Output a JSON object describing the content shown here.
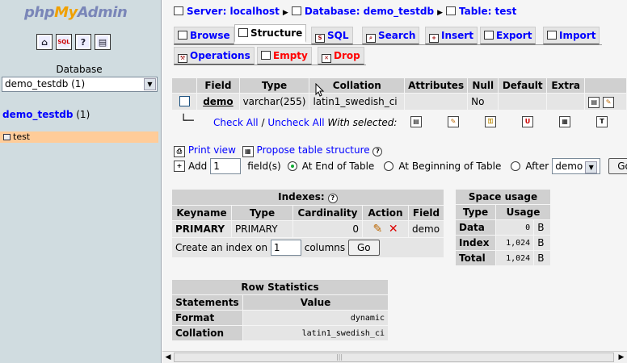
{
  "left": {
    "logo": {
      "php": "php",
      "my": "My",
      "admin": "Admin"
    },
    "icons": [
      "home-icon",
      "sql-query-icon",
      "help-icon",
      "docs-icon"
    ],
    "db_label": "Database",
    "db_selected": "demo_testdb (1)",
    "db_link_name": "demo_testdb",
    "db_link_count": "(1)",
    "table_item": "test",
    "bg_color": "#d0dce0",
    "highlight_color": "#ffcc99"
  },
  "breadcrumb": {
    "server": "Server: localhost",
    "database": "Database: demo_testdb",
    "table": "Table: test"
  },
  "tabs": {
    "browse": "Browse",
    "structure": "Structure",
    "sql": "SQL",
    "search": "Search",
    "insert": "Insert",
    "export": "Export",
    "import": "Import",
    "operations": "Operations",
    "empty": "Empty",
    "drop": "Drop"
  },
  "structure": {
    "headers": [
      "Field",
      "Type",
      "Collation",
      "Attributes",
      "Null",
      "Default",
      "Extra"
    ],
    "row": {
      "field": "demo",
      "type": "varchar(255)",
      "collation": "latin1_swedish_ci",
      "attributes": "",
      "null": "No",
      "default": "",
      "extra": ""
    },
    "check_all": "Check All",
    "slash": "/",
    "uncheck_all": "Uncheck All",
    "with_selected": "With selected:"
  },
  "tools": {
    "print_view": "Print view",
    "propose": "Propose table structure",
    "add": "Add",
    "add_count": "1",
    "fields": "field(s)",
    "at_end": "At End of Table",
    "at_beginning": "At Beginning of Table",
    "after": "After",
    "after_field": "demo",
    "go": "Go"
  },
  "indexes": {
    "title": "Indexes:",
    "headers": [
      "Keyname",
      "Type",
      "Cardinality",
      "Action",
      "Field"
    ],
    "row": {
      "keyname": "PRIMARY",
      "type": "PRIMARY",
      "cardinality": "0",
      "field": "demo"
    },
    "create_label": "Create an index on",
    "create_count": "1",
    "columns": "columns",
    "go": "Go"
  },
  "space": {
    "title": "Space usage",
    "headers": [
      "Type",
      "Usage"
    ],
    "rows": [
      {
        "type": "Data",
        "value": "0",
        "unit": "B"
      },
      {
        "type": "Index",
        "value": "1,024",
        "unit": "B"
      },
      {
        "type": "Total",
        "value": "1,024",
        "unit": "B"
      }
    ]
  },
  "row_stats": {
    "title": "Row Statistics",
    "headers": [
      "Statements",
      "Value"
    ],
    "rows": [
      {
        "label": "Format",
        "value": "dynamic"
      },
      {
        "label": "Collation",
        "value": "latin1_swedish_ci"
      }
    ]
  }
}
